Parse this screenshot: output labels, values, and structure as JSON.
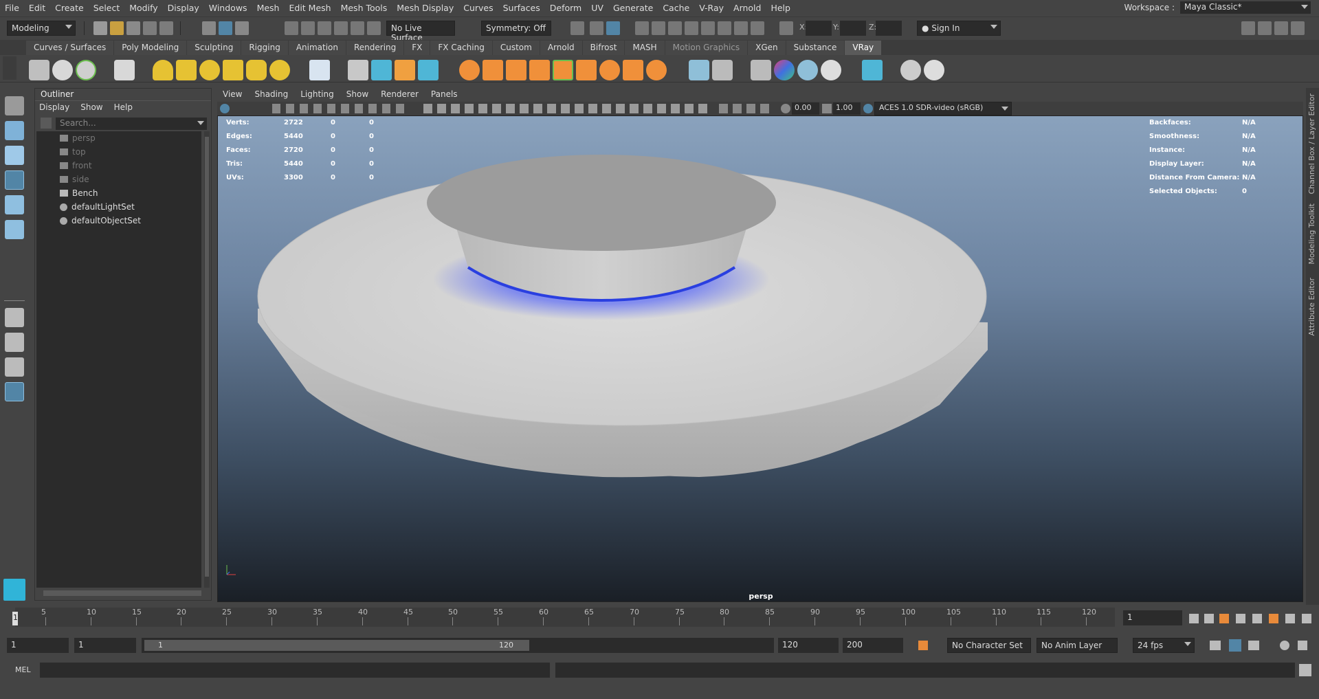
{
  "menubar": {
    "items": [
      "File",
      "Edit",
      "Create",
      "Select",
      "Modify",
      "Display",
      "Windows",
      "Mesh",
      "Edit Mesh",
      "Mesh Tools",
      "Mesh Display",
      "Curves",
      "Surfaces",
      "Deform",
      "UV",
      "Generate",
      "Cache",
      "V-Ray",
      "Arnold",
      "Help"
    ],
    "workspace_label": "Workspace :",
    "workspace_value": "Maya Classic*"
  },
  "statusline": {
    "mode": "Modeling",
    "live_surface": "No Live Surface",
    "symmetry": "Symmetry: Off",
    "x_label": "X:",
    "y_label": "Y:",
    "z_label": "Z:",
    "sign_in": "Sign In"
  },
  "shelf": {
    "tabs": [
      "Curves / Surfaces",
      "Poly Modeling",
      "Sculpting",
      "Rigging",
      "Animation",
      "Rendering",
      "FX",
      "FX Caching",
      "Custom",
      "Arnold",
      "Bifrost",
      "MASH",
      "Motion Graphics",
      "XGen",
      "Substance",
      "VRay"
    ],
    "active_tab": "VRay"
  },
  "outliner": {
    "title": "Outliner",
    "menu": [
      "Display",
      "Show",
      "Help"
    ],
    "search_placeholder": "Search...",
    "items": [
      {
        "label": "persp",
        "type": "camera",
        "dim": true
      },
      {
        "label": "top",
        "type": "camera",
        "dim": true
      },
      {
        "label": "front",
        "type": "camera",
        "dim": true
      },
      {
        "label": "side",
        "type": "camera",
        "dim": true
      },
      {
        "label": "Bench",
        "type": "transform",
        "dim": false
      },
      {
        "label": "defaultLightSet",
        "type": "set",
        "dim": false
      },
      {
        "label": "defaultObjectSet",
        "type": "set",
        "dim": false
      }
    ]
  },
  "viewport": {
    "menu": [
      "View",
      "Shading",
      "Lighting",
      "Show",
      "Renderer",
      "Panels"
    ],
    "exposure": "0.00",
    "gamma": "1.00",
    "color_space": "ACES 1.0 SDR-video (sRGB)",
    "camera_label": "persp",
    "hud_left": [
      {
        "label": "Verts:",
        "a": "2722",
        "b": "0",
        "c": "0"
      },
      {
        "label": "Edges:",
        "a": "5440",
        "b": "0",
        "c": "0"
      },
      {
        "label": "Faces:",
        "a": "2720",
        "b": "0",
        "c": "0"
      },
      {
        "label": "Tris:",
        "a": "5440",
        "b": "0",
        "c": "0"
      },
      {
        "label": "UVs:",
        "a": "3300",
        "b": "0",
        "c": "0"
      }
    ],
    "hud_right": [
      {
        "label": "Backfaces:",
        "value": "N/A"
      },
      {
        "label": "Smoothness:",
        "value": "N/A"
      },
      {
        "label": "Instance:",
        "value": "N/A"
      },
      {
        "label": "Display Layer:",
        "value": "N/A"
      },
      {
        "label": "Distance From Camera:",
        "value": "N/A"
      },
      {
        "label": "Selected Objects:",
        "value": "0"
      }
    ]
  },
  "right_panel_tabs": [
    "Channel Box / Layer Editor",
    "Modeling Toolkit",
    "Attribute Editor"
  ],
  "timeline": {
    "ticks": [
      "5",
      "10",
      "15",
      "20",
      "25",
      "30",
      "35",
      "40",
      "45",
      "50",
      "55",
      "60",
      "65",
      "70",
      "75",
      "80",
      "85",
      "90",
      "95",
      "100",
      "105",
      "110",
      "115",
      "120"
    ],
    "start_marker": "1",
    "current_frame": "1"
  },
  "range": {
    "start": "1",
    "playback_start": "1",
    "slider_start": "1",
    "slider_end": "120",
    "playback_end": "120",
    "end": "200",
    "character_set": "No Character Set",
    "anim_layer": "No Anim Layer",
    "fps": "24 fps"
  },
  "command": {
    "label": "MEL"
  },
  "colors": {
    "accent": "#5285a6",
    "glow": "#3a4dff"
  }
}
